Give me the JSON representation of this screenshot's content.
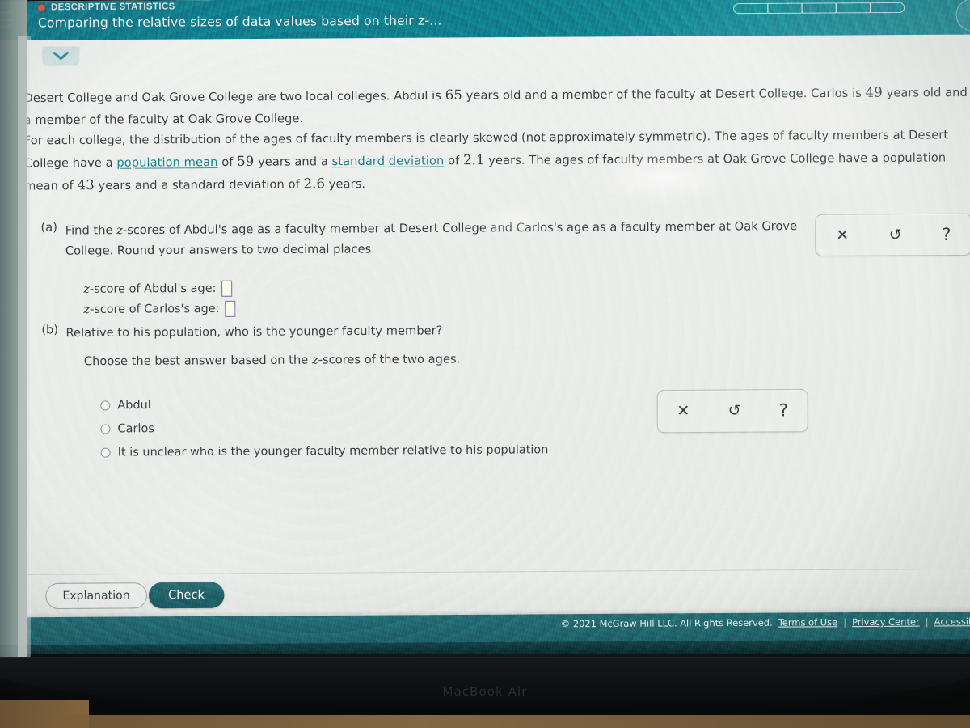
{
  "header": {
    "menu_icon": "hamburger-icon",
    "topic_label": "DESCRIPTIVE STATISTICS",
    "topic_dot_color": "#e8473f",
    "lesson_title": "Comparing the relative sizes of data values based on their z-...",
    "background_color": "#0b6f7f",
    "progress": {
      "total_segments": 5,
      "filled_segments": 0
    },
    "avatar": "user-avatar-icon"
  },
  "tab": {
    "icon": "chevron-down-icon",
    "color": "#2f8593"
  },
  "problem": {
    "paragraph1_parts": {
      "t1": "Desert College and Oak Grove College are two local colleges. Abdul is ",
      "n1": "65",
      "t2": " years old and a member of the faculty at Desert College. Carlos is ",
      "n2": "49",
      "t3": " years old and a member of the faculty at Oak Grove College."
    },
    "paragraph2_parts": {
      "t1": "For each college, the distribution of the ages of faculty members is clearly skewed (not approximately symmetric). The ages of faculty members at Desert College have a ",
      "link1": "population mean",
      "t2": " of ",
      "n1": "59",
      "t3": " years and a ",
      "link2": "standard deviation",
      "t4": " of ",
      "n2": "2.1",
      "t5": " years. The ages of faculty members at Oak Grove College have a population mean of ",
      "n3": "43",
      "t6": " years and a standard deviation of ",
      "n4": "2.6",
      "t7": " years."
    }
  },
  "part_a": {
    "label": "(a)",
    "prompt_line1_a": "Find the ",
    "prompt_var": "z",
    "prompt_line1_b": "-scores of Abdul's age as a faculty member at Desert College and Carlos's age as a faculty member at Oak Grove",
    "prompt_line2": "College. Round your answers to two decimal places.",
    "field1_label_a": "-score of Abdul's age:",
    "field1_value": "",
    "field2_label_a": "-score of Carlos's age:",
    "field2_value": "",
    "var_symbol": "z",
    "field_border_color": "#6a62a8"
  },
  "part_b": {
    "label": "(b)",
    "prompt": "Relative to his population, who is the younger faculty member?",
    "instruction_a": "Choose the best answer based on the ",
    "instruction_var": "z",
    "instruction_b": "-scores of the two ages.",
    "options": [
      {
        "label": "Abdul",
        "selected": false
      },
      {
        "label": "Carlos",
        "selected": false
      },
      {
        "label": "It is unclear who is the younger faculty member relative to his population",
        "selected": false
      }
    ]
  },
  "tools": {
    "panel_a": [
      {
        "icon": "close-x-icon",
        "glyph": "✕",
        "name": "clear"
      },
      {
        "icon": "undo-arrow-icon",
        "glyph": "↺",
        "name": "undo"
      },
      {
        "icon": "question-mark-icon",
        "glyph": "?",
        "name": "help"
      }
    ],
    "panel_b": [
      {
        "icon": "close-x-icon",
        "glyph": "✕",
        "name": "clear"
      },
      {
        "icon": "undo-arrow-icon",
        "glyph": "↺",
        "name": "undo"
      },
      {
        "icon": "question-mark-icon",
        "glyph": "?",
        "name": "help"
      }
    ]
  },
  "buttons": {
    "explanation": "Explanation",
    "check": "Check",
    "check_color": "#1a545d"
  },
  "footer": {
    "copyright": "© 2021 McGraw Hill LLC. All Rights Reserved.",
    "terms": "Terms of Use",
    "sep1": "|",
    "privacy": "Privacy Center",
    "sep2": "|",
    "accessibility": "Accessib"
  },
  "device": {
    "label": "MacBook Air"
  }
}
